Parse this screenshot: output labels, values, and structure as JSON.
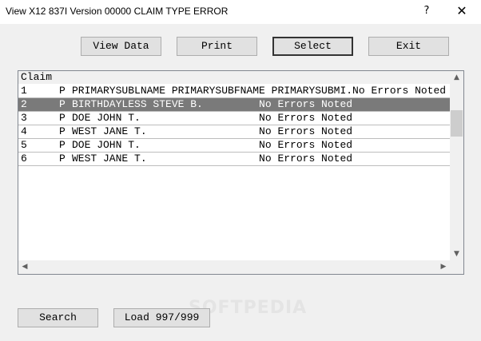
{
  "window": {
    "title": "View X12 837I Version 00000 CLAIM TYPE ERROR",
    "help_glyph": "?",
    "close_glyph": "✕"
  },
  "toolbar": {
    "view_data": "View Data",
    "print": "Print",
    "select": "Select",
    "exit": "Exit"
  },
  "list": {
    "header": "Claim",
    "rows": [
      {
        "num": "1",
        "type": "P",
        "name": "PRIMARYSUBLNAME PRIMARYSUBFNAME PRIMARYSUBMI.No Errors Noted"
      },
      {
        "num": "2",
        "type": "P",
        "name": "BIRTHDAYLESS STEVE B.         No Errors Noted"
      },
      {
        "num": "3",
        "type": "P",
        "name": "DOE JOHN T.                   No Errors Noted"
      },
      {
        "num": "4",
        "type": "P",
        "name": "WEST JANE T.                  No Errors Noted"
      },
      {
        "num": "5",
        "type": "P",
        "name": "DOE JOHN T.                   No Errors Noted"
      },
      {
        "num": "6",
        "type": "P",
        "name": "WEST JANE T.                  No Errors Noted"
      }
    ],
    "selected_index": 1
  },
  "bottom": {
    "search": "Search",
    "load": "Load 997/999"
  },
  "icons": {
    "scroll_up": "▲",
    "scroll_down": "▼",
    "scroll_left": "◀",
    "scroll_right": "▶"
  },
  "watermark": "SOFTPEDIA"
}
